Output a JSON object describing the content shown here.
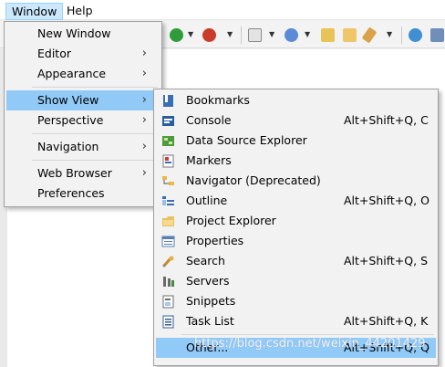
{
  "menubar": {
    "items": [
      {
        "label": "Window",
        "active": true
      },
      {
        "label": "Help",
        "active": false
      }
    ]
  },
  "window_menu": {
    "items": [
      {
        "label": "New Window",
        "submenu": false
      },
      {
        "label": "Editor",
        "submenu": true
      },
      {
        "label": "Appearance",
        "submenu": true
      },
      {
        "label": "Show View",
        "submenu": true,
        "highlighted": true
      },
      {
        "label": "Perspective",
        "submenu": true
      },
      {
        "label": "Navigation",
        "submenu": true
      },
      {
        "label": "Web Browser",
        "submenu": true
      },
      {
        "label": "Preferences",
        "submenu": false
      }
    ]
  },
  "show_view_menu": {
    "items": [
      {
        "label": "Bookmarks",
        "shortcut": "",
        "icon": "bookmarks-icon"
      },
      {
        "label": "Console",
        "shortcut": "Alt+Shift+Q, C",
        "icon": "console-icon"
      },
      {
        "label": "Data Source Explorer",
        "shortcut": "",
        "icon": "data-source-explorer-icon"
      },
      {
        "label": "Markers",
        "shortcut": "",
        "icon": "markers-icon"
      },
      {
        "label": "Navigator (Deprecated)",
        "shortcut": "",
        "icon": "navigator-icon"
      },
      {
        "label": "Outline",
        "shortcut": "Alt+Shift+Q, O",
        "icon": "outline-icon"
      },
      {
        "label": "Project Explorer",
        "shortcut": "",
        "icon": "project-explorer-icon"
      },
      {
        "label": "Properties",
        "shortcut": "",
        "icon": "properties-icon"
      },
      {
        "label": "Search",
        "shortcut": "Alt+Shift+Q, S",
        "icon": "search-icon"
      },
      {
        "label": "Servers",
        "shortcut": "",
        "icon": "servers-icon"
      },
      {
        "label": "Snippets",
        "shortcut": "",
        "icon": "snippets-icon"
      },
      {
        "label": "Task List",
        "shortcut": "Alt+Shift+Q, K",
        "icon": "task-list-icon"
      },
      {
        "label": "Other...",
        "shortcut": "Alt+Shift+Q, Q",
        "icon": "",
        "highlighted": true
      }
    ]
  },
  "watermark": "https://blog.csdn.net/weixin_44201429",
  "colors": {
    "highlight": "#91c9f7",
    "menu_bg": "#f2f2f2",
    "menubar_active": "#cce8ff"
  }
}
